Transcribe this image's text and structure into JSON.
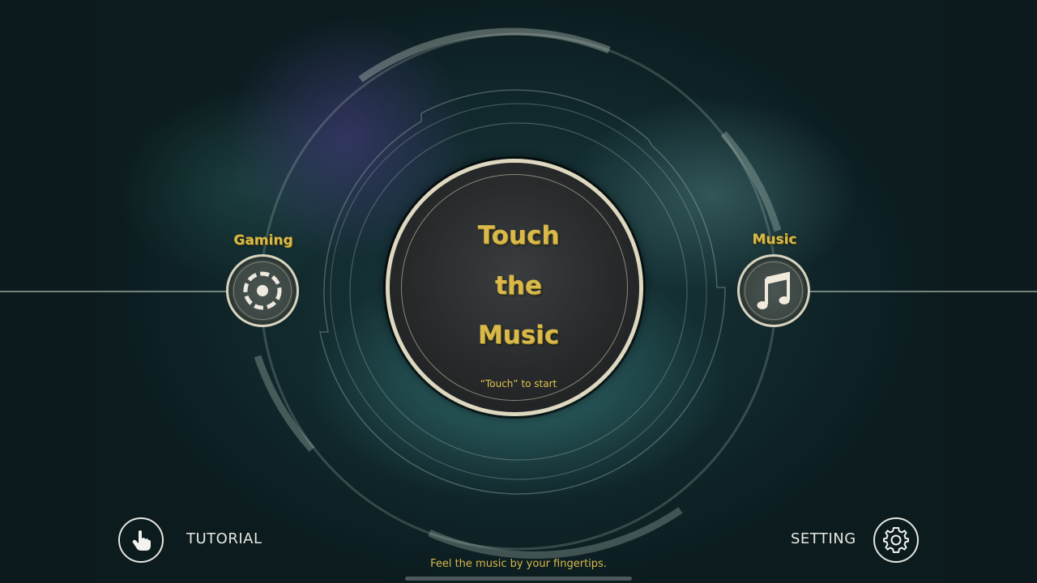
{
  "center": {
    "title_lines": [
      "Touch",
      "the",
      "Music"
    ],
    "start_hint": "“Touch” to start"
  },
  "modes": {
    "left": {
      "label": "Gaming",
      "icon": "target-dashed-icon"
    },
    "right": {
      "label": "Music",
      "icon": "music-note-icon"
    }
  },
  "bottom": {
    "tutorial_label": "TUTORIAL",
    "tutorial_icon": "hand-pointer-icon",
    "setting_label": "SETTING",
    "setting_icon": "gear-icon",
    "tagline": "Feel the music by your fingertips."
  },
  "colors": {
    "accent_gold": "#d8b94a",
    "ring_cream": "#ddd8bf",
    "background": "#0b1b1e"
  }
}
